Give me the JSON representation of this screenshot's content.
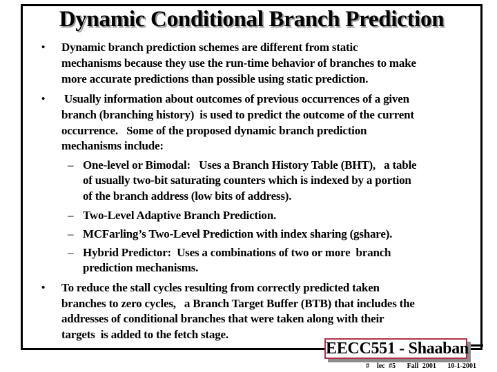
{
  "slide": {
    "title": "Dynamic Conditional Branch Prediction",
    "bullets": [
      {
        "marker": "•",
        "lines": [
          "Dynamic branch prediction schemes are different from static",
          "mechanisms because they use the run-time behavior of branches to make",
          "more accurate  predictions than possible using static prediction."
        ]
      },
      {
        "marker": "•",
        "lines": [
          " Usually information about outcomes of previous occurrences of a given",
          "branch (branching history)  is used to predict the outcome of the current",
          "occurrence.   Some of the proposed dynamic branch prediction",
          "mechanisms include:"
        ],
        "sub_items": [
          {
            "marker": "–",
            "lines": [
              "One-level or Bimodal:   Uses a Branch History Table (BHT),   a table",
              "of usually two-bit saturating counters which is indexed by a portion",
              "of the branch address (low bits of address)."
            ]
          },
          {
            "marker": "–",
            "lines": [
              "Two-Level Adaptive Branch Prediction."
            ]
          },
          {
            "marker": "–",
            "lines": [
              "MCFarling’s Two-Level Prediction with index sharing (gshare)."
            ]
          },
          {
            "marker": "–",
            "lines": [
              "Hybrid Predictor:  Uses a combinations of two or more  branch",
              "prediction mechanisms."
            ]
          }
        ]
      },
      {
        "marker": "•",
        "lines": [
          "To reduce the stall cycles resulting from correctly predicted taken",
          "branches to zero cycles,   a Branch Target Buffer (BTB) that includes the",
          "addresses of conditional branches that were taken along with their",
          "targets  is added to the fetch stage."
        ]
      }
    ],
    "course_label": "EECC551 - Shaaban",
    "footer": "#  lec #5   Fall 2001   10-1-2001"
  }
}
